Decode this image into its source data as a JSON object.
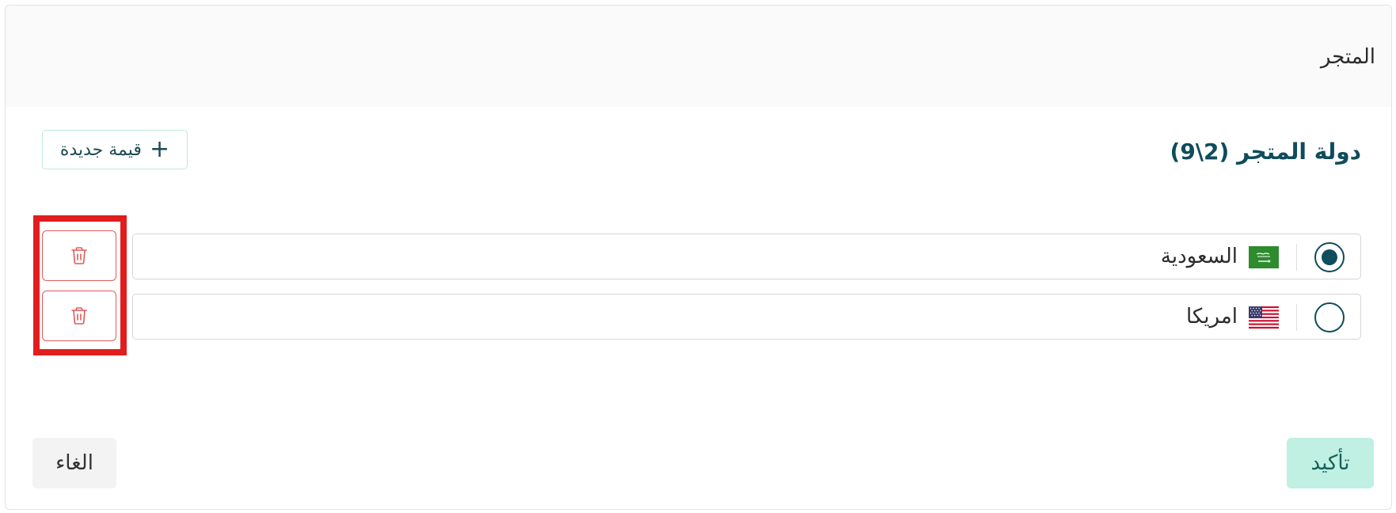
{
  "modal": {
    "title": "المتجر"
  },
  "section": {
    "title": "دولة المتجر (2\\9)",
    "add_button_label": "قيمة جديدة",
    "add_icon": "plus-icon"
  },
  "options": [
    {
      "label": "السعودية",
      "flag_icon": "saudi-flag-icon",
      "selected": true
    },
    {
      "label": "امريكا",
      "flag_icon": "usa-flag-icon",
      "selected": false
    }
  ],
  "delete_icon": "trash-icon",
  "footer": {
    "confirm_label": "تأكيد",
    "cancel_label": "الغاء"
  },
  "colors": {
    "primary": "#0f4c5c",
    "confirm_bg": "#bff0e2",
    "delete": "#e25a5a",
    "highlight": "#e11d1d",
    "saudi_green": "#2e8b2e"
  }
}
